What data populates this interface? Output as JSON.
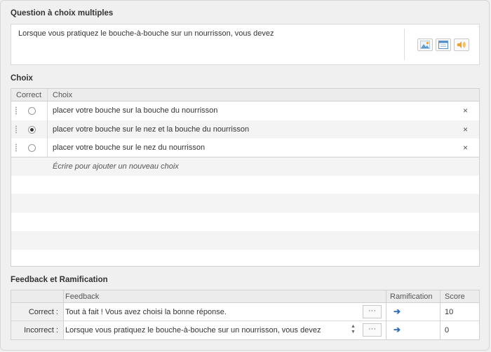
{
  "question": {
    "title": "Question à choix multiples",
    "text": "Lorsque vous pratiquez le bouche-à-bouche sur un nourrisson, vous devez",
    "tools": [
      {
        "icon": "image-icon"
      },
      {
        "icon": "window-icon"
      },
      {
        "icon": "speaker-icon"
      }
    ]
  },
  "choices": {
    "title": "Choix",
    "header": {
      "correct": "Correct",
      "choice": "Choix"
    },
    "items": [
      {
        "text": "placer votre bouche sur la bouche du nourrisson",
        "selected": false
      },
      {
        "text": "placer votre bouche sur le nez et la bouche du nourrisson",
        "selected": true
      },
      {
        "text": "placer votre bouche sur le nez du nourrisson",
        "selected": false
      }
    ],
    "delete_symbol": "×",
    "add_placeholder": "Écrire pour ajouter un nouveau choix"
  },
  "feedback": {
    "title": "Feedback et Ramification",
    "header": {
      "feedback": "Feedback",
      "branching": "Ramification",
      "score": "Score"
    },
    "rows": [
      {
        "label": "Correct :",
        "text": "Tout à fait ! Vous avez choisi la bonne réponse.",
        "more": "···",
        "arrow": "➔",
        "score": "10"
      },
      {
        "label": "Incorrect :",
        "text": "Lorsque vous pratiquez le bouche-à-bouche sur un nourrisson, vous devez",
        "more": "···",
        "arrow": "➔",
        "score": "0"
      }
    ],
    "accent_color": "#2d6db5"
  }
}
